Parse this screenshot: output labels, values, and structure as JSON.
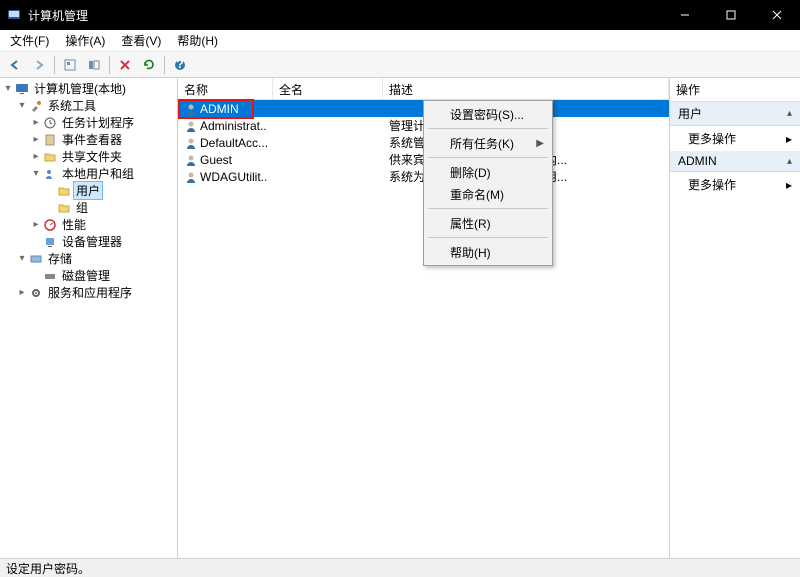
{
  "window": {
    "title": "计算机管理"
  },
  "menubar": {
    "file": "文件(F)",
    "action": "操作(A)",
    "view": "查看(V)",
    "help": "帮助(H)"
  },
  "toolbar_icons": {
    "back": "back-icon",
    "forward": "forward-icon",
    "up": "up-icon",
    "show_hide": "show-hide-icon",
    "delete": "delete-icon",
    "refresh": "refresh-icon",
    "help": "help-icon"
  },
  "tree": {
    "root": "计算机管理(本地)",
    "system_tools": "系统工具",
    "task_scheduler": "任务计划程序",
    "event_viewer": "事件查看器",
    "shared_folders": "共享文件夹",
    "local_users": "本地用户和组",
    "users": "用户",
    "groups": "组",
    "performance": "性能",
    "device_manager": "设备管理器",
    "storage": "存储",
    "disk_mgmt": "磁盘管理",
    "services_apps": "服务和应用程序"
  },
  "list": {
    "headers": {
      "name": "名称",
      "full": "全名",
      "desc": "描述"
    },
    "rows": [
      {
        "name": "ADMIN",
        "full": "",
        "desc": ""
      },
      {
        "name": "Administrat..",
        "full": "",
        "desc": "管理计算机(域)的内置帐户"
      },
      {
        "name": "DefaultAcc...",
        "full": "",
        "desc": "系统管理的用户帐户。"
      },
      {
        "name": "Guest",
        "full": "",
        "desc": "供来宾访问计算机或访问域的内..."
      },
      {
        "name": "WDAGUtilit..",
        "full": "",
        "desc": "系统为 Windows Defender 应用..."
      }
    ]
  },
  "context_menu": {
    "set_password": "设置密码(S)...",
    "all_tasks": "所有任务(K)",
    "delete": "删除(D)",
    "rename": "重命名(M)",
    "properties": "属性(R)",
    "help": "帮助(H)"
  },
  "actions_pane": {
    "title": "操作",
    "group_user": "用户",
    "group_admin": "ADMIN",
    "more_actions": "更多操作"
  },
  "statusbar": {
    "text": "设定用户密码。"
  }
}
